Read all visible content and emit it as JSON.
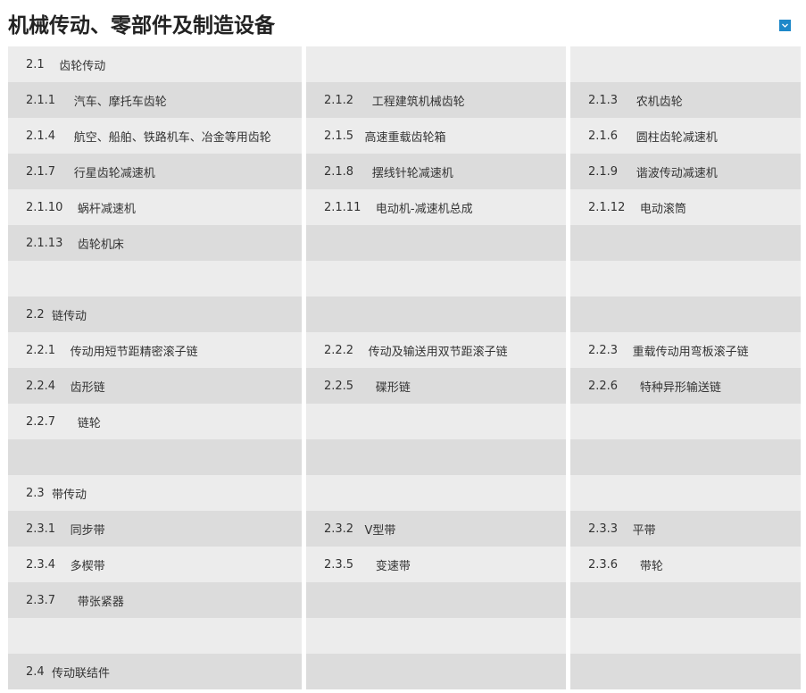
{
  "page": {
    "title": "机械传动、零部件及制造设备"
  },
  "toggle": {
    "icon": "chevron-down-icon",
    "color": "#1e88c9"
  },
  "rows": [
    [
      {
        "code": "2.1",
        "gap": "    ",
        "label": "齿轮传动"
      },
      {
        "code": "",
        "gap": "",
        "label": ""
      },
      {
        "code": "",
        "gap": "",
        "label": ""
      }
    ],
    [
      {
        "code": "2.1.1",
        "gap": "     ",
        "label": "汽车、摩托车齿轮"
      },
      {
        "code": "2.1.2",
        "gap": "     ",
        "label": "工程建筑机械齿轮"
      },
      {
        "code": "2.1.3",
        "gap": "     ",
        "label": "农机齿轮"
      }
    ],
    [
      {
        "code": "2.1.4",
        "gap": "     ",
        "label": "航空、船舶、铁路机车、冶金等用齿轮"
      },
      {
        "code": "2.1.5",
        "gap": "   ",
        "label": "高速重载齿轮箱"
      },
      {
        "code": "2.1.6",
        "gap": "     ",
        "label": "圆柱齿轮减速机"
      }
    ],
    [
      {
        "code": "2.1.7",
        "gap": "     ",
        "label": "行星齿轮减速机"
      },
      {
        "code": "2.1.8",
        "gap": "     ",
        "label": "摆线针轮减速机"
      },
      {
        "code": "2.1.9",
        "gap": "     ",
        "label": "谐波传动减速机"
      }
    ],
    [
      {
        "code": "2.1.10",
        "gap": "    ",
        "label": "蜗杆减速机"
      },
      {
        "code": "2.1.11",
        "gap": "    ",
        "label": "电动机-减速机总成"
      },
      {
        "code": "2.1.12",
        "gap": "    ",
        "label": "电动滚筒"
      }
    ],
    [
      {
        "code": "2.1.13",
        "gap": "    ",
        "label": "齿轮机床"
      },
      {
        "code": "",
        "gap": "",
        "label": ""
      },
      {
        "code": "",
        "gap": "",
        "label": ""
      }
    ],
    [
      {
        "code": "",
        "gap": "",
        "label": ""
      },
      {
        "code": "",
        "gap": "",
        "label": ""
      },
      {
        "code": "",
        "gap": "",
        "label": ""
      }
    ],
    [
      {
        "code": "2.2",
        "gap": "  ",
        "label": "链传动"
      },
      {
        "code": "",
        "gap": "",
        "label": ""
      },
      {
        "code": "",
        "gap": "",
        "label": ""
      }
    ],
    [
      {
        "code": "2.2.1",
        "gap": "    ",
        "label": "传动用短节距精密滚子链"
      },
      {
        "code": "2.2.2",
        "gap": "    ",
        "label": "传动及输送用双节距滚子链"
      },
      {
        "code": "2.2.3",
        "gap": "    ",
        "label": "重载传动用弯板滚子链"
      }
    ],
    [
      {
        "code": "2.2.4",
        "gap": "    ",
        "label": "齿形链"
      },
      {
        "code": "2.2.5",
        "gap": "      ",
        "label": "碟形链"
      },
      {
        "code": "2.2.6",
        "gap": "      ",
        "label": "特种异形输送链"
      }
    ],
    [
      {
        "code": "2.2.7",
        "gap": "      ",
        "label": "链轮"
      },
      {
        "code": "",
        "gap": "",
        "label": ""
      },
      {
        "code": "",
        "gap": "",
        "label": ""
      }
    ],
    [
      {
        "code": "",
        "gap": "",
        "label": ""
      },
      {
        "code": "",
        "gap": "",
        "label": ""
      },
      {
        "code": "",
        "gap": "",
        "label": ""
      }
    ],
    [
      {
        "code": "2.3",
        "gap": "  ",
        "label": "带传动"
      },
      {
        "code": "",
        "gap": "",
        "label": ""
      },
      {
        "code": "",
        "gap": "",
        "label": ""
      }
    ],
    [
      {
        "code": "2.3.1",
        "gap": "    ",
        "label": "同步带"
      },
      {
        "code": "2.3.2",
        "gap": "   ",
        "label": "V型带"
      },
      {
        "code": "2.3.3",
        "gap": "    ",
        "label": "平带"
      }
    ],
    [
      {
        "code": "2.3.4",
        "gap": "    ",
        "label": "多楔带"
      },
      {
        "code": "2.3.5",
        "gap": "      ",
        "label": "变速带"
      },
      {
        "code": "2.3.6",
        "gap": "      ",
        "label": "带轮"
      }
    ],
    [
      {
        "code": "2.3.7",
        "gap": "      ",
        "label": "带张紧器"
      },
      {
        "code": "",
        "gap": "",
        "label": ""
      },
      {
        "code": "",
        "gap": "",
        "label": ""
      }
    ],
    [
      {
        "code": "",
        "gap": "",
        "label": ""
      },
      {
        "code": "",
        "gap": "",
        "label": ""
      },
      {
        "code": "",
        "gap": "",
        "label": ""
      }
    ],
    [
      {
        "code": "2.4",
        "gap": "  ",
        "label": "传动联结件"
      },
      {
        "code": "",
        "gap": "",
        "label": ""
      },
      {
        "code": "",
        "gap": "",
        "label": ""
      }
    ]
  ],
  "colors": {
    "row_light": "#ececec",
    "row_dark": "#dcdcdc",
    "text": "#333333",
    "title": "#222222",
    "accent": "#1e88c9"
  }
}
